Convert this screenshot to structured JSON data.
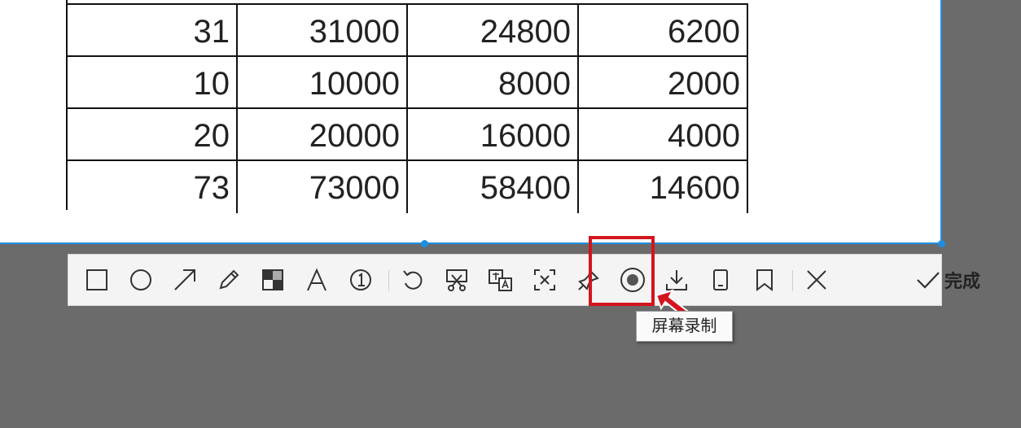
{
  "table": {
    "rows": [
      [
        "31",
        "31000",
        "24800",
        "6200"
      ],
      [
        "10",
        "10000",
        "8000",
        "2000"
      ],
      [
        "20",
        "20000",
        "16000",
        "4000"
      ],
      [
        "73",
        "73000",
        "58400",
        "14600"
      ]
    ]
  },
  "toolbar": {
    "tools": [
      {
        "name": "rectangle-icon"
      },
      {
        "name": "ellipse-icon"
      },
      {
        "name": "arrow-icon"
      },
      {
        "name": "pencil-icon"
      },
      {
        "name": "mosaic-icon"
      },
      {
        "name": "text-icon"
      },
      {
        "name": "number-marker-icon"
      },
      {
        "name": "undo-icon"
      },
      {
        "name": "cutout-icon"
      },
      {
        "name": "translate-icon"
      },
      {
        "name": "ocr-icon"
      },
      {
        "name": "pin-icon"
      },
      {
        "name": "screen-record-icon"
      },
      {
        "name": "download-icon"
      },
      {
        "name": "phone-icon"
      },
      {
        "name": "bookmark-icon"
      },
      {
        "name": "close-icon"
      }
    ],
    "done_label": "完成"
  },
  "tooltip": {
    "text": "屏幕录制"
  },
  "colors": {
    "selection": "#1e8fe0",
    "highlight": "#d4141b",
    "background": "#6b6b6b"
  }
}
